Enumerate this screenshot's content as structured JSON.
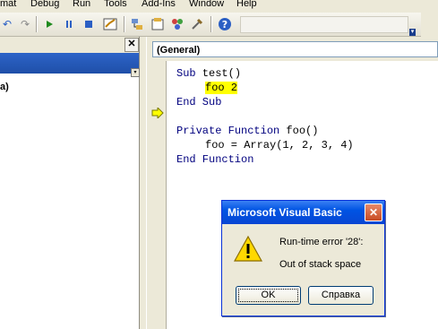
{
  "menu": {
    "items": [
      "mat",
      "Debug",
      "Run",
      "Tools",
      "Add-Ins",
      "Window",
      "Help"
    ]
  },
  "toolbar": {
    "icons": [
      "undo-icon",
      "redo-icon",
      "run-icon",
      "break-icon",
      "reset-icon",
      "design-mode-icon",
      "project-explorer-icon",
      "properties-icon",
      "object-browser-icon",
      "toolbox-icon",
      "help-icon"
    ]
  },
  "left_panel": {
    "close_label": "✕",
    "item_text": "a)"
  },
  "code_window": {
    "object_combo": "(General)",
    "lines": {
      "l1_kw": "Sub",
      "l1_rest": " test()",
      "l2_code": "foo 2",
      "l3": "End Sub",
      "l5_kw1": "Private",
      "l5_kw2": "Function",
      "l5_rest": " foo()",
      "l6": "foo = Array(1, 2, 3, 4)",
      "l7": "End Function"
    }
  },
  "dialog": {
    "title": "Microsoft Visual Basic",
    "message_line1": "Run-time error '28':",
    "message_line2": "Out of stack space",
    "ok_label": "OK",
    "help_label": "Справка"
  },
  "colors": {
    "keyword": "#00007f",
    "highlight": "#ffff00",
    "titlebar": "#0054e3"
  }
}
